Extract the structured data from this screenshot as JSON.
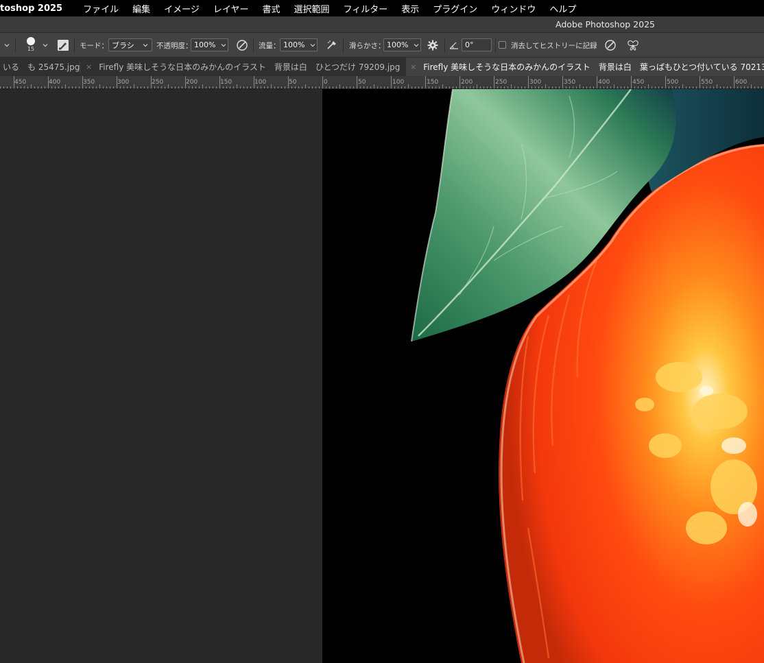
{
  "menubar": {
    "app_name": "toshop 2025",
    "items": [
      "ファイル",
      "編集",
      "イメージ",
      "レイヤー",
      "書式",
      "選択範囲",
      "フィルター",
      "表示",
      "プラグイン",
      "ウィンドウ",
      "ヘルプ"
    ]
  },
  "window": {
    "title": "Adobe Photoshop 2025"
  },
  "options": {
    "brush_size": "15",
    "mode_label": "モード：",
    "mode_value": "ブラシ",
    "opacity_label": "不透明度：",
    "opacity_value": "100%",
    "flow_label": "流量：",
    "flow_value": "100%",
    "smoothing_label": "滑らかさ：",
    "smoothing_value": "100%",
    "angle_value": "0°",
    "erase_history_label": "消去してヒストリーに記録"
  },
  "tabs": [
    {
      "label": "いる　も 25475.jpg",
      "active": false,
      "close": ""
    },
    {
      "label": "Firefly 美味しそうな日本のみかんのイラスト　背景は白　ひとつだけ 79209.jpg",
      "active": false,
      "close": "×"
    },
    {
      "label": "Firefly 美味しそうな日本のみかんのイラスト　背景は白　葉っぱもひとつ付いている 70213",
      "active": true,
      "close": "×"
    }
  ],
  "ruler": {
    "labels": [
      "450",
      "400",
      "350",
      "300",
      "250",
      "200",
      "150",
      "100",
      "50",
      "0",
      "50",
      "100",
      "150",
      "200",
      "250",
      "300",
      "350",
      "400",
      "450",
      "500",
      "550",
      "600"
    ]
  },
  "colors": {
    "leaf_dark": "#1f6b45",
    "leaf_light": "#8fc79b",
    "orange": "#ff4a10",
    "orange_core": "#ffb23a",
    "canvas_bg": "#000000",
    "pasteboard": "#282828"
  }
}
